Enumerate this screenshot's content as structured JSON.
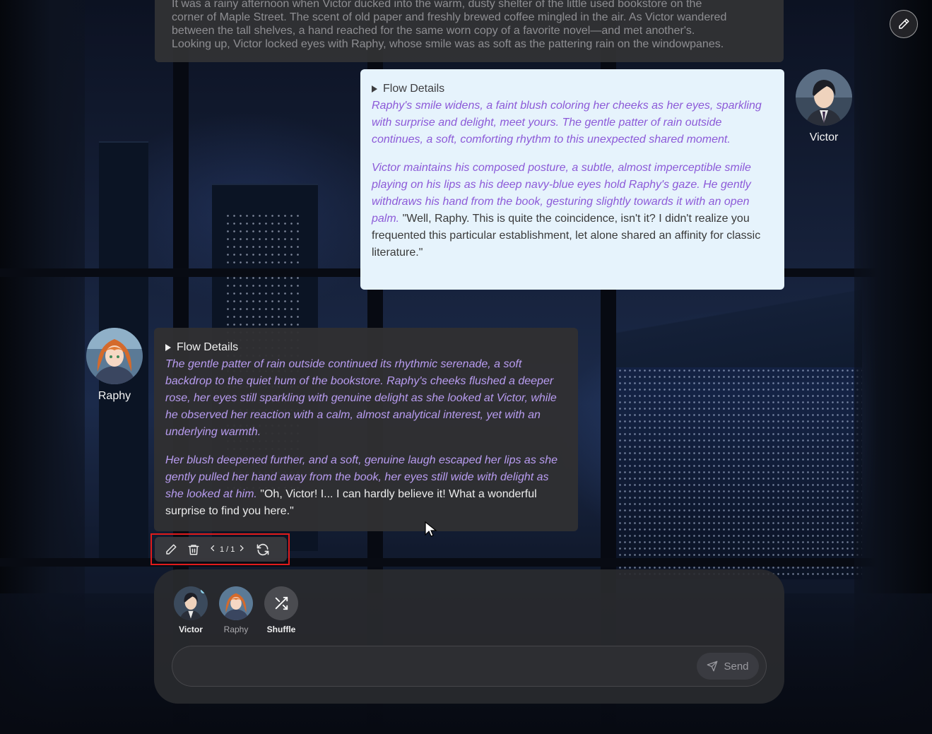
{
  "top_message": {
    "text_line1": "It was a rainy afternoon when Victor ducked into the warm, dusty shelter of the little used bookstore on the",
    "text_line2": "corner of Maple Street. The scent of old paper and freshly brewed coffee mingled in the air. As Victor wandered",
    "text_line3": "between the tall shelves, a hand reached for the same worn copy of a favorite novel—and met another's.",
    "text_line4": "Looking up, Victor locked eyes with Raphy, whose smile was as soft as the pattering rain on the windowpanes."
  },
  "victor_message": {
    "summary": "Flow Details",
    "para1_action": "Raphy's smile widens, a faint blush coloring her cheeks as her eyes, sparkling with surprise and delight, meet yours. The gentle patter of rain outside continues, a soft, comforting rhythm to this unexpected shared moment.",
    "para2_action": "Victor maintains his composed posture, a subtle, almost imperceptible smile playing on his lips as his deep navy-blue eyes hold Raphy's gaze. He gently withdraws his hand from the book, gesturing slightly towards it with an open palm.",
    "para2_speech": " \"Well, Raphy. This is quite the coincidence, isn't it? I didn't realize you frequented this particular establishment, let alone shared an affinity for classic literature.\"",
    "author_name": "Victor"
  },
  "raphy_message": {
    "summary": "Flow Details",
    "para1_action": "The gentle patter of rain outside continued its rhythmic serenade, a soft backdrop to the quiet hum of the bookstore. Raphy's cheeks flushed a deeper rose, her eyes still sparkling with genuine delight as she looked at Victor, while he observed her reaction with a calm, almost analytical interest, yet with an underlying warmth.",
    "para2_action": "Her blush deepened further, and a soft, genuine laugh escaped her lips as she gently pulled her hand away from the book, her eyes still wide with delight as she looked at him.",
    "para2_speech": " \"Oh, Victor! I... I can hardly believe it! What a wonderful surprise to find you here.\"",
    "author_name": "Raphy"
  },
  "toolbar": {
    "pager": "1 / 1",
    "icons": [
      "pencil-icon",
      "trash-icon",
      "chevron-left-icon",
      "chevron-right-icon",
      "refresh-icon"
    ]
  },
  "composer": {
    "characters": [
      {
        "label": "Victor",
        "active": true
      },
      {
        "label": "Raphy",
        "active": false
      },
      {
        "label": "Shuffle",
        "active": false
      }
    ],
    "input_value": "",
    "send_label": "Send"
  },
  "colors": {
    "victor_bubble": "#e6f3fc",
    "victor_action": "#8c5ad8",
    "raphy_bubble": "#303032",
    "raphy_action": "#b89cf0",
    "highlight": "#e01b1b"
  }
}
